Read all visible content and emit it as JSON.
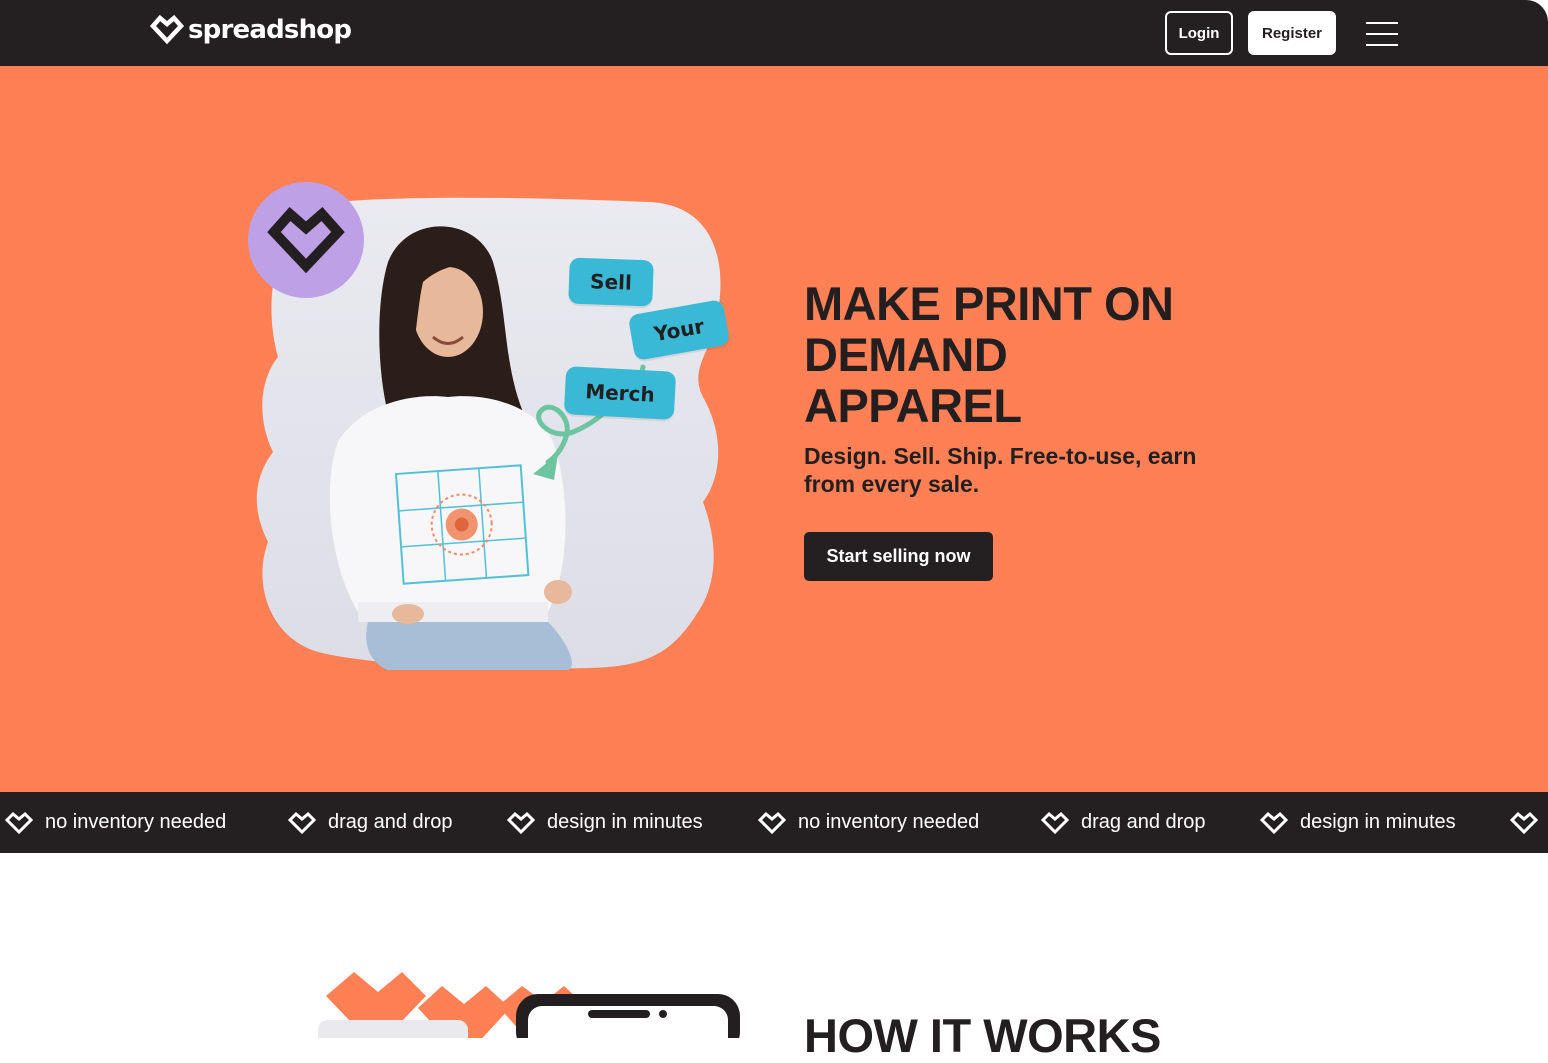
{
  "brand": {
    "name": "spreadshop"
  },
  "nav": {
    "login_label": "Login",
    "register_label": "Register",
    "menu_icon": "hamburger-icon"
  },
  "hero": {
    "headline": "MAKE PRINT ON DEMAND APPAREL",
    "subhead": "Design. Sell. Ship. Free-to-use, earn from every sale.",
    "cta_label": "Start selling now",
    "tags": [
      "Sell",
      "Your",
      "Merch"
    ]
  },
  "ticker": {
    "items": [
      "no inventory needed",
      "drag and drop",
      "design in minutes",
      "no inventory needed",
      "drag and drop",
      "design in minutes"
    ]
  },
  "how_it_works": {
    "title": "HOW IT WORKS"
  },
  "colors": {
    "dark": "#242021",
    "hero_bg": "#ff8055",
    "tag_blue": "#39b9d6",
    "badge_purple": "#bda0e6",
    "arrow_green": "#6cc4a1"
  }
}
